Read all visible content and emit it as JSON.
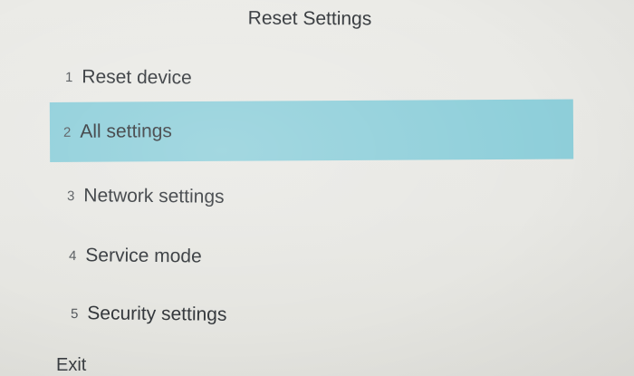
{
  "header": {
    "title": "Reset Settings"
  },
  "menu": {
    "items": [
      {
        "number": "1",
        "label": "Reset device",
        "selected": false
      },
      {
        "number": "2",
        "label": "All settings",
        "selected": true
      },
      {
        "number": "3",
        "label": "Network settings",
        "selected": false
      },
      {
        "number": "4",
        "label": "Service mode",
        "selected": false
      },
      {
        "number": "5",
        "label": "Security settings",
        "selected": false
      }
    ],
    "selected_color": "#8fcfda"
  },
  "footer": {
    "exit_label": "Exit"
  }
}
